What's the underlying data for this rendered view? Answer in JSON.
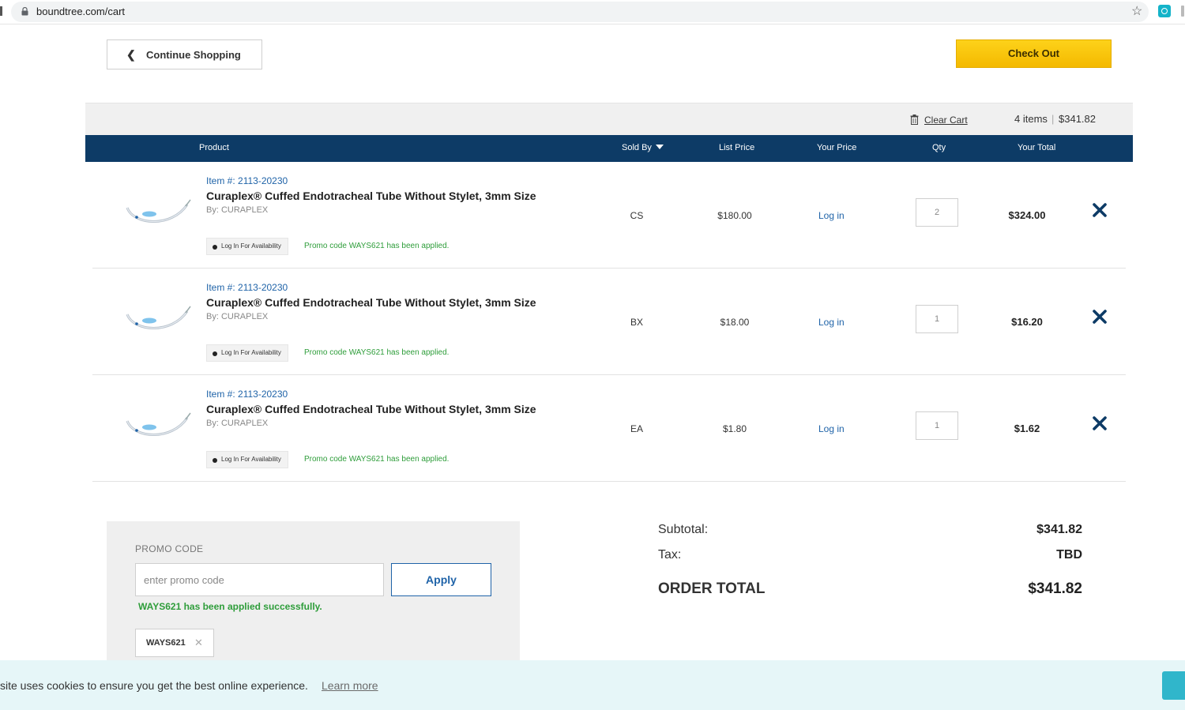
{
  "browser": {
    "url": "boundtree.com/cart"
  },
  "top": {
    "continue_label": "Continue Shopping",
    "checkout_label": "Check Out"
  },
  "cart_bar": {
    "clear_cart": "Clear Cart",
    "items": "4 items",
    "separator": "|",
    "total": "$341.82"
  },
  "table": {
    "headers": {
      "product": "Product",
      "sold_by": "Sold By",
      "list_price": "List Price",
      "your_price": "Your Price",
      "qty": "Qty",
      "your_total": "Your Total"
    },
    "rows": [
      {
        "item_no": "Item #: 2113-20230",
        "name": "Curaplex® Cuffed Endotracheal Tube Without Stylet, 3mm Size",
        "by": "By: CURAPLEX",
        "availability": "Log In For Availability",
        "promo": "Promo code WAYS621 has been applied.",
        "sold_by": "CS",
        "list_price": "$180.00",
        "your_price": "Log in",
        "qty": "2",
        "total": "$324.00"
      },
      {
        "item_no": "Item #: 2113-20230",
        "name": "Curaplex® Cuffed Endotracheal Tube Without Stylet, 3mm Size",
        "by": "By: CURAPLEX",
        "availability": "Log In For Availability",
        "promo": "Promo code WAYS621 has been applied.",
        "sold_by": "BX",
        "list_price": "$18.00",
        "your_price": "Log in",
        "qty": "1",
        "total": "$16.20"
      },
      {
        "item_no": "Item #: 2113-20230",
        "name": "Curaplex® Cuffed Endotracheal Tube Without Stylet, 3mm Size",
        "by": "By: CURAPLEX",
        "availability": "Log In For Availability",
        "promo": "Promo code WAYS621 has been applied.",
        "sold_by": "EA",
        "list_price": "$1.80",
        "your_price": "Log in",
        "qty": "1",
        "total": "$1.62"
      }
    ]
  },
  "promo": {
    "title": "PROMO CODE",
    "placeholder": "enter promo code",
    "apply_label": "Apply",
    "success": "WAYS621 has been applied successfully.",
    "applied_code": "WAYS621",
    "remove_glyph": "✕"
  },
  "summary": {
    "subtotal_label": "Subtotal:",
    "subtotal": "$341.82",
    "tax_label": "Tax:",
    "tax": "TBD",
    "order_total_label": "ORDER TOTAL",
    "order_total": "$341.82"
  },
  "cookie": {
    "text": "site uses cookies to ensure you get the best online experience.",
    "learn_more": "Learn more"
  },
  "colors": {
    "header_navy": "#0d3b66",
    "link_blue": "#1f63a8",
    "promo_green": "#2e9d3a",
    "checkout_yellow": "#f4b900"
  }
}
